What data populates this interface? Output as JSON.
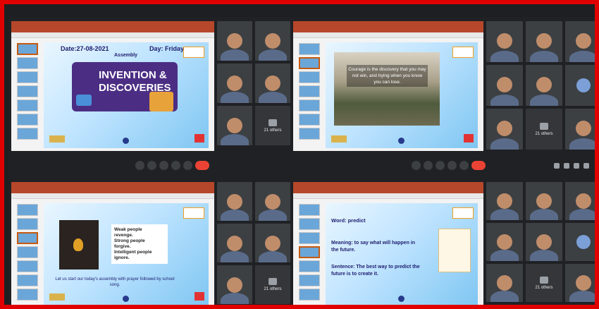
{
  "colors": {
    "frame": "#e00000",
    "meet_bg": "#202124",
    "end_call": "#ea4335"
  },
  "slide1": {
    "date": "Date:27-08-2021",
    "day": "Day: Friday",
    "heading": "Assembly",
    "title_line1": "INVENTION &",
    "title_line2": "DISCOVERIES"
  },
  "slide2": {
    "quote": "Courage is the discovery that you may not win, and trying when you know you can lose."
  },
  "slide3": {
    "quote_lines": [
      "Weak people",
      "revenge.",
      "Strong people",
      "forgive.",
      "Intelligent people",
      "ignore."
    ],
    "footer": "Let us start our today's assembly with prayer followed by school song."
  },
  "slide4": {
    "word": "Word: predict",
    "meaning": "Meaning: to say what will happen in the future.",
    "sentence": "Sentence: The best way to predict the future is to create it."
  },
  "tiles_left_top": [
    {
      "type": "person"
    },
    {
      "type": "person"
    },
    {
      "type": "person"
    },
    {
      "type": "person"
    },
    {
      "type": "person"
    },
    {
      "type": "others",
      "label": "21 others"
    }
  ],
  "tiles_right_top": [
    {
      "type": "person"
    },
    {
      "type": "person"
    },
    {
      "type": "person"
    },
    {
      "type": "person"
    },
    {
      "type": "person"
    },
    {
      "type": "avatar"
    },
    {
      "type": "person"
    },
    {
      "type": "others",
      "label": "21 others"
    },
    {
      "type": "person"
    }
  ],
  "tiles_left_bottom": [
    {
      "type": "person"
    },
    {
      "type": "person"
    },
    {
      "type": "person"
    },
    {
      "type": "person"
    },
    {
      "type": "person"
    },
    {
      "type": "others",
      "label": "21 others"
    }
  ],
  "tiles_right_bottom": [
    {
      "type": "person"
    },
    {
      "type": "person"
    },
    {
      "type": "person"
    },
    {
      "type": "person"
    },
    {
      "type": "person"
    },
    {
      "type": "avatar"
    },
    {
      "type": "person"
    },
    {
      "type": "others",
      "label": "21 others"
    },
    {
      "type": "person"
    }
  ]
}
